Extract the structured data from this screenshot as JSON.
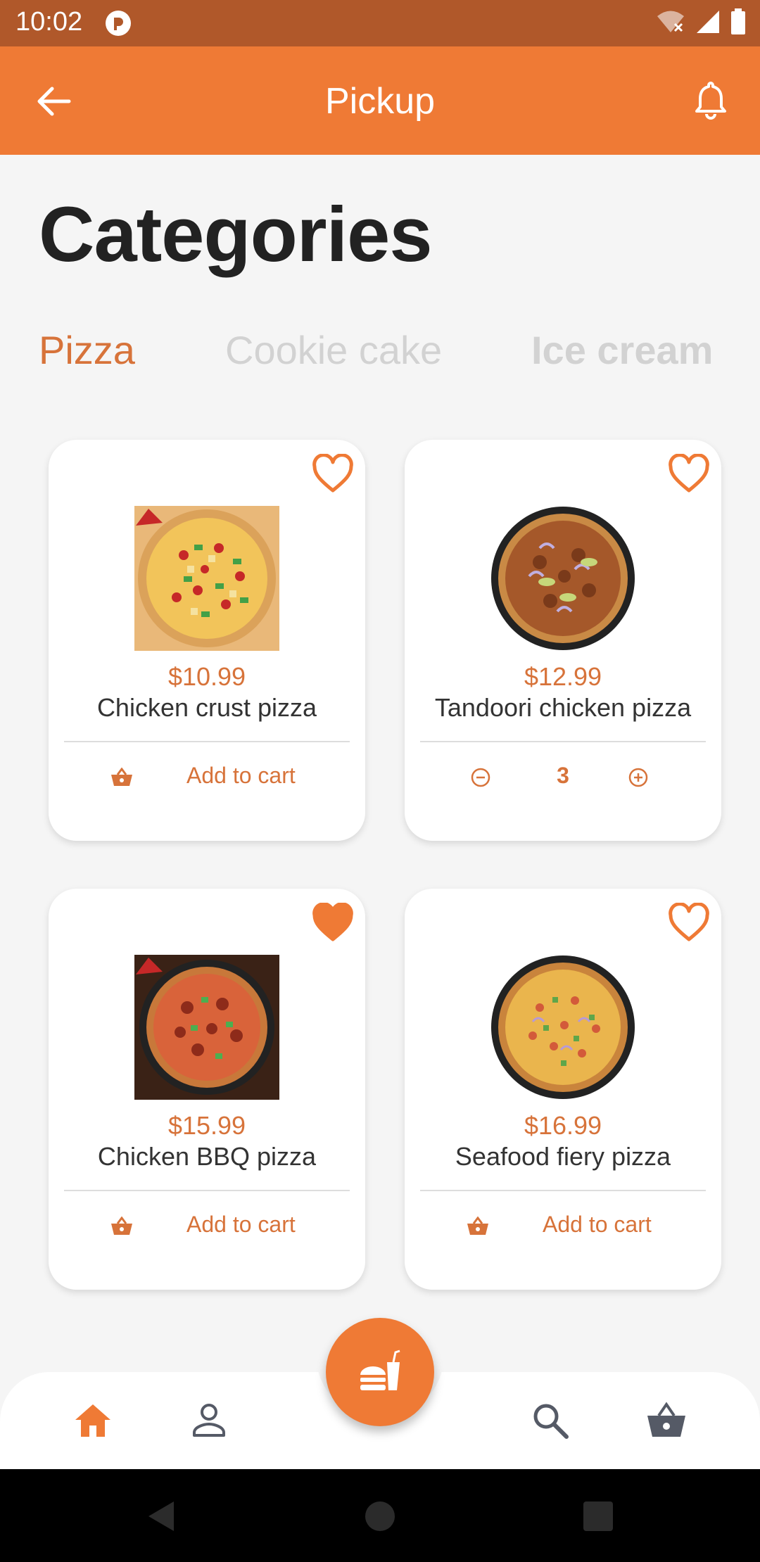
{
  "status_bar": {
    "time": "10:02",
    "icons": [
      "app-notification-icon",
      "wifi-off-icon",
      "signal-icon",
      "battery-icon"
    ]
  },
  "app_bar": {
    "title": "Pickup",
    "back_icon": "arrow-left-icon",
    "bell_icon": "bell-icon"
  },
  "page": {
    "heading": "Categories"
  },
  "tabs": [
    {
      "label": "Pizza",
      "active": true
    },
    {
      "label": "Cookie cake",
      "active": false
    },
    {
      "label": "Ice cream",
      "active": false
    }
  ],
  "products": [
    {
      "price": "$10.99",
      "name": "Chicken crust pizza",
      "favorite": false,
      "action_label": "Add to cart",
      "in_cart": false
    },
    {
      "price": "$12.99",
      "name": "Tandoori chicken pizza",
      "favorite": false,
      "in_cart": true,
      "quantity": "3"
    },
    {
      "price": "$15.99",
      "name": "Chicken BBQ pizza",
      "favorite": true,
      "action_label": "Add to cart",
      "in_cart": false
    },
    {
      "price": "$16.99",
      "name": "Seafood fiery pizza",
      "favorite": false,
      "action_label": "Add to cart",
      "in_cart": false
    }
  ],
  "bottom_nav": {
    "items": [
      "home-icon",
      "profile-icon",
      "search-icon",
      "basket-icon"
    ],
    "fab_icon": "fast-food-icon"
  },
  "colors": {
    "accent": "#ef7a35",
    "status_bar": "#b0582a",
    "price": "#d7733a",
    "inactive_tab": "#d2d2d2",
    "nav_icon": "#555a66"
  }
}
